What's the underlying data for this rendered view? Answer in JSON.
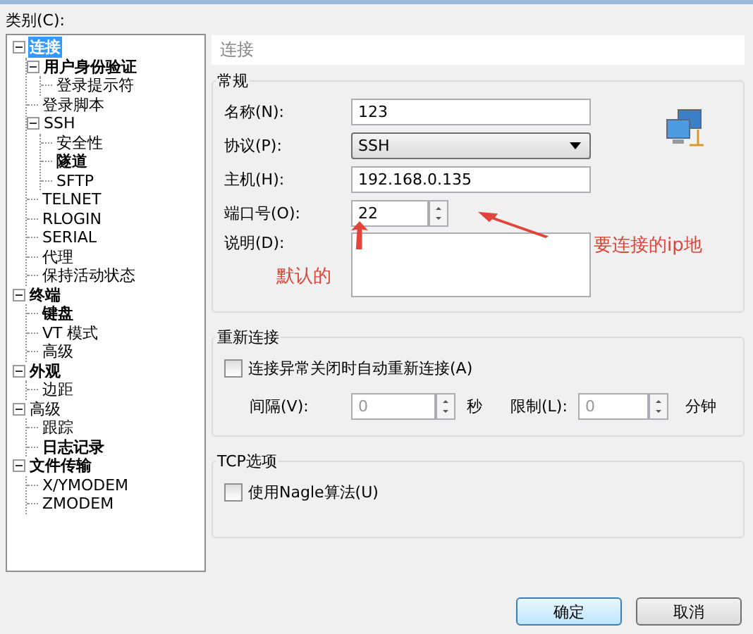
{
  "category_label": "类别(C):",
  "tree": [
    {
      "label": "连接",
      "selected": true,
      "bold": true,
      "expanded": true,
      "children": [
        {
          "label": "用户身份验证",
          "selected": false,
          "bold": true,
          "expanded": true,
          "children": [
            {
              "label": "登录提示符",
              "selected": false,
              "bold": false
            }
          ]
        },
        {
          "label": "登录脚本",
          "selected": false,
          "bold": false
        },
        {
          "label": "SSH",
          "selected": false,
          "bold": false,
          "expanded": true,
          "children": [
            {
              "label": "安全性",
              "selected": false,
              "bold": false
            },
            {
              "label": "隧道",
              "selected": false,
              "bold": true
            },
            {
              "label": "SFTP",
              "selected": false,
              "bold": false
            }
          ]
        },
        {
          "label": "TELNET",
          "selected": false,
          "bold": false
        },
        {
          "label": "RLOGIN",
          "selected": false,
          "bold": false
        },
        {
          "label": "SERIAL",
          "selected": false,
          "bold": false
        },
        {
          "label": "代理",
          "selected": false,
          "bold": false
        },
        {
          "label": "保持活动状态",
          "selected": false,
          "bold": false
        }
      ]
    },
    {
      "label": "终端",
      "selected": false,
      "bold": true,
      "expanded": true,
      "children": [
        {
          "label": "键盘",
          "selected": false,
          "bold": true
        },
        {
          "label": "VT 模式",
          "selected": false,
          "bold": false
        },
        {
          "label": "高级",
          "selected": false,
          "bold": false
        }
      ]
    },
    {
      "label": "外观",
      "selected": false,
      "bold": true,
      "expanded": true,
      "children": [
        {
          "label": "边距",
          "selected": false,
          "bold": false
        }
      ]
    },
    {
      "label": "高级",
      "selected": false,
      "bold": false,
      "expanded": true,
      "children": [
        {
          "label": "跟踪",
          "selected": false,
          "bold": false
        },
        {
          "label": "日志记录",
          "selected": false,
          "bold": true
        }
      ]
    },
    {
      "label": "文件传输",
      "selected": false,
      "bold": true,
      "expanded": true,
      "children": [
        {
          "label": "X/YMODEM",
          "selected": false,
          "bold": false
        },
        {
          "label": "ZMODEM",
          "selected": false,
          "bold": false
        }
      ]
    }
  ],
  "header": "连接",
  "general": {
    "title": "常规",
    "name_label": "名称(N):",
    "name_value": "123",
    "protocol_label": "协议(P):",
    "protocol_value": "SSH",
    "host_label": "主机(H):",
    "host_value": "192.168.0.135",
    "port_label": "端口号(O):",
    "port_value": "22",
    "description_label": "说明(D):"
  },
  "annotations": [
    "要连接的ip地",
    "默认的"
  ],
  "reconnect": {
    "title": "重新连接",
    "checkbox": {
      "label": "连接异常关闭时自动重新连接(A)",
      "checked": false
    },
    "interval_label": "间隔(V):",
    "interval_value": "0",
    "interval_unit": "秒",
    "limit_label": "限制(L):",
    "limit_value": "0",
    "limit_unit": "分钟"
  },
  "tcp": {
    "title": "TCP选项",
    "checkbox": {
      "label": "使用Nagle算法(U)",
      "checked": false
    }
  },
  "buttons": [
    {
      "label": "确定",
      "default": true
    },
    {
      "label": "取消",
      "default": false
    }
  ]
}
